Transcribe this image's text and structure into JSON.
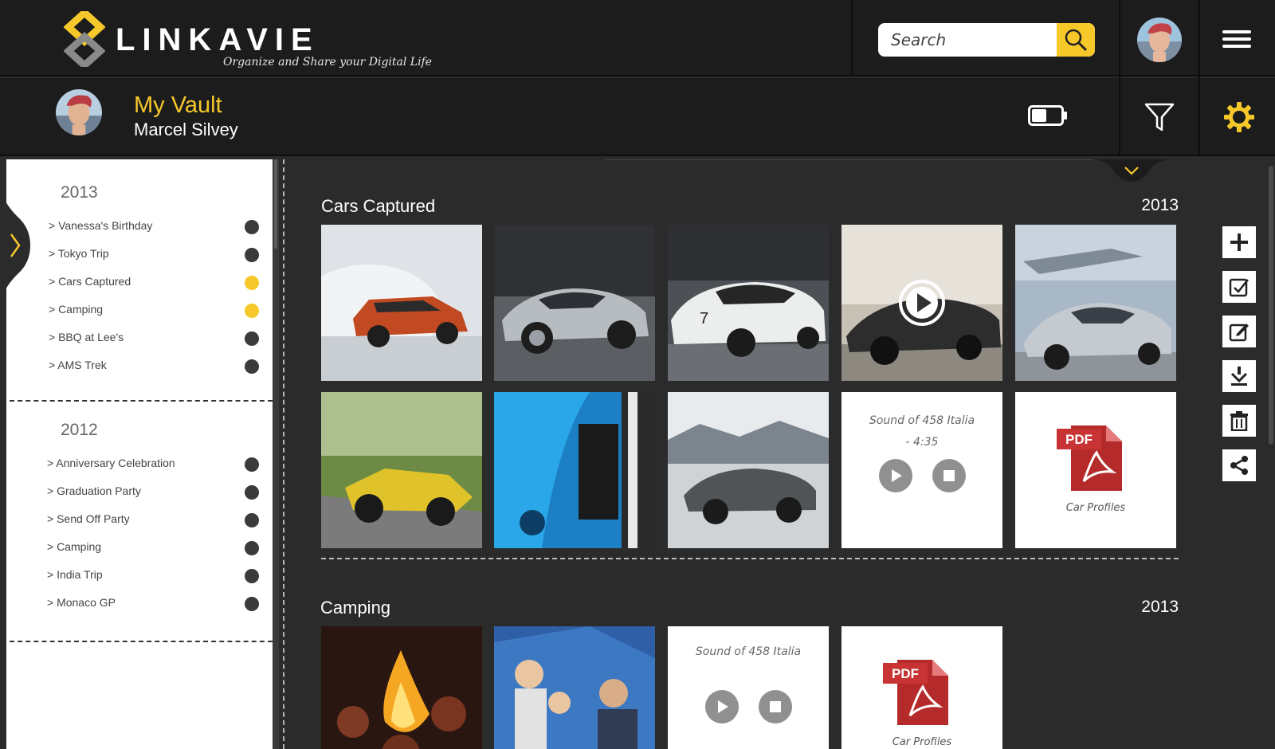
{
  "app": {
    "logo_text": "LINKAVIE",
    "tagline": "Organize and Share your Digital Life"
  },
  "search": {
    "placeholder": "Search"
  },
  "vault": {
    "title": "My Vault",
    "user": "Marcel Silvey"
  },
  "colors": {
    "accent": "#f6c82a",
    "bar": "#1c1c1c",
    "content": "#2b2b2b"
  },
  "sidebar": {
    "groups": [
      {
        "year": "2013",
        "events": [
          {
            "label": "> Vanessa's Birthday",
            "active": false
          },
          {
            "label": "> Tokyo Trip",
            "active": false
          },
          {
            "label": "> Cars Captured",
            "active": true
          },
          {
            "label": "> Camping",
            "active": true
          },
          {
            "label": "> BBQ at Lee's",
            "active": false
          },
          {
            "label": "> AMS Trek",
            "active": false
          }
        ]
      },
      {
        "year": "2012",
        "events": [
          {
            "label": "> Anniversary Celebration",
            "active": false
          },
          {
            "label": "> Graduation Party",
            "active": false
          },
          {
            "label": "> Send Off Party",
            "active": false
          },
          {
            "label": "> Camping",
            "active": false
          },
          {
            "label": "> India Trip",
            "active": false
          },
          {
            "label": "> Monaco GP",
            "active": false
          }
        ]
      }
    ]
  },
  "sections": [
    {
      "title": "Cars Captured",
      "year": "2013",
      "tiles": [
        {
          "kind": "photo",
          "subject": "orange SUV drifting in snow"
        },
        {
          "kind": "photo",
          "subject": "silver sports coupe"
        },
        {
          "kind": "photo",
          "subject": "white race car number 7"
        },
        {
          "kind": "video",
          "subject": "dark supercar"
        },
        {
          "kind": "photo",
          "subject": "silver hypercar with jets"
        },
        {
          "kind": "photo",
          "subject": "yellow roadster"
        },
        {
          "kind": "photo",
          "subject": "blue muscle car front"
        },
        {
          "kind": "photo",
          "subject": "grey coupe on snowy road"
        },
        {
          "kind": "audio",
          "caption": "Sound of  458 Italia",
          "duration": "- 4:35"
        },
        {
          "kind": "pdf",
          "badge": "PDF",
          "caption": "Car Profiles"
        }
      ]
    },
    {
      "title": "Camping",
      "year": "2013",
      "tiles": [
        {
          "kind": "photo",
          "subject": "campfire"
        },
        {
          "kind": "photo",
          "subject": "family at tent"
        },
        {
          "kind": "audio",
          "caption": "Sound of  458 Italia"
        },
        {
          "kind": "pdf",
          "badge": "PDF",
          "caption": "Car Profiles"
        }
      ]
    }
  ],
  "icons": {
    "search": "search-icon",
    "menu": "hamburger-menu-icon",
    "battery": "battery-icon",
    "filter": "filter-funnel-icon",
    "settings": "gear-icon",
    "tools": [
      "plus-icon",
      "checkbox-icon",
      "edit-icon",
      "download-icon",
      "trash-icon",
      "share-icon"
    ]
  }
}
